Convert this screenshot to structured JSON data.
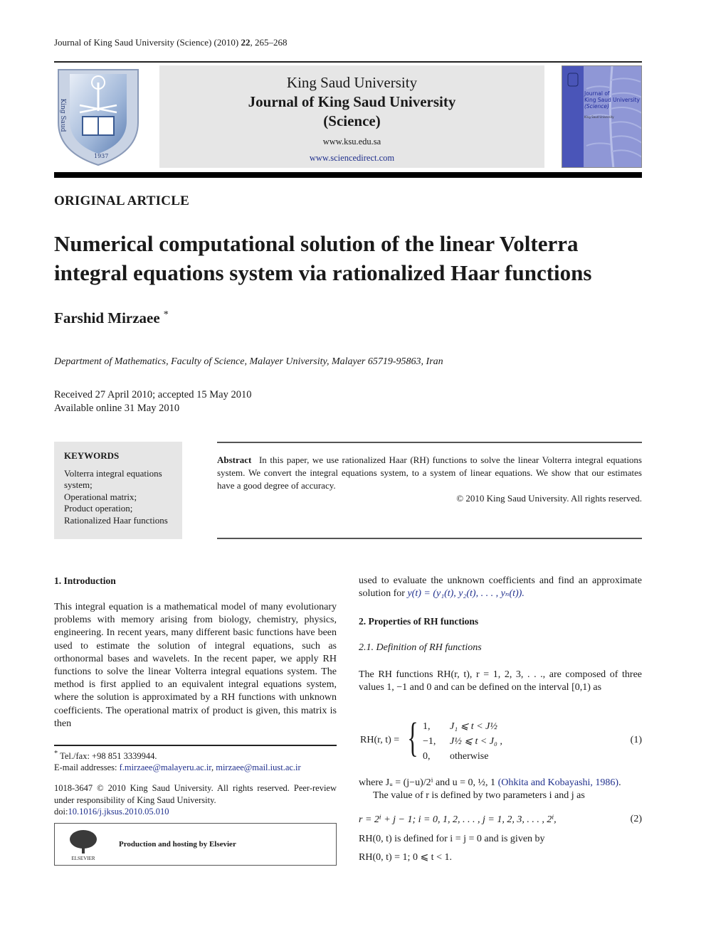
{
  "running_head": {
    "prefix": "Journal of King Saud University (Science) (2010) ",
    "volume": "22",
    "pages": ", 265–268"
  },
  "banner": {
    "logo": "king-saud-university-seal",
    "logo_year": "1937",
    "university": "King Saud University",
    "journal_line1": "Journal of King Saud University",
    "journal_line2": "(Science)",
    "url1": "www.ksu.edu.sa",
    "url2": "www.sciencedirect.com",
    "cover": {
      "line1": "Journal of",
      "line2": "King Saud University",
      "line3": "(Science)",
      "small": "King Saud University"
    }
  },
  "article_type": "ORIGINAL ARTICLE",
  "title": "Numerical computational solution of the linear Volterra integral equations system via rationalized Haar functions",
  "author": {
    "name": "Farshid Mirzaee",
    "marker": "*"
  },
  "affiliation": "Department of Mathematics, Faculty of Science, Malayer University, Malayer 65719-95863, Iran",
  "dates": {
    "received": "Received 27 April 2010; accepted 15 May 2010",
    "online": "Available online 31 May 2010"
  },
  "keywords": {
    "heading": "KEYWORDS",
    "items": [
      "Volterra integral equations system;",
      "Operational matrix;",
      "Product operation;",
      "Rationalized Haar functions"
    ]
  },
  "abstract": {
    "label": "Abstract",
    "text": "In this paper, we use rationalized Haar (RH) functions to solve the linear Volterra integral equations system. We convert the integral equations system, to a system of linear equations. We show that our estimates have a good degree of accuracy.",
    "copyright": "© 2010 King Saud University. All rights reserved."
  },
  "sections": {
    "intro_heading": "1. Introduction",
    "intro_text": "This integral equation is a mathematical model of many evolutionary problems with memory arising from biology, chemistry, physics, engineering. In recent years, many different basic functions have been used to estimate the solution of integral equations, such as orthonormal bases and wavelets. In the recent paper, we apply RH functions to solve the linear Volterra integral equations system. The method is first applied to an equivalent integral equations system, where the solution is approximated by a RH functions with unknown coefficients. The operational matrix of product is given, this matrix is then",
    "right_cont": "used to evaluate the unknown coefficients and find an approximate solution for ",
    "right_cont_math": "y(t) = (y₁(t), y₂(t), . . . , yₙ(t)).",
    "sec2_heading": "2. Properties of RH functions",
    "sec21_heading": "2.1. Definition of RH functions",
    "sec21_text": "The RH functions RH(r, t), r = 1, 2, 3, . . ., are composed of three values 1, −1 and 0 and can be defined on the interval [0,1) as",
    "eq1": {
      "lhs": "RH(r, t) =",
      "cases": [
        {
          "value": "1,",
          "cond": "J₁ ⩽ t < J½"
        },
        {
          "value": "−1,",
          "cond": "J½ ⩽ t < J₀ ,"
        },
        {
          "value": "0,",
          "cond": "otherwise"
        }
      ],
      "number": "(1)"
    },
    "where_text": "where Jᵤ = (j−u)/2ⁱ and u = 0, ½, 1 ",
    "where_cite": "(Ohkita and Kobayashi, 1986)",
    "where_end": ".",
    "r_def": "The value of r is defined by two parameters i and j as",
    "eq2": {
      "text": "r = 2ⁱ + j − 1;    i = 0, 1, 2, . . . ,    j = 1, 2, 3, . . . , 2ⁱ,",
      "number": "(2)"
    },
    "rh0_text": "RH(0, t) is defined for i = j = 0 and is given by",
    "rh0_eq": "RH(0, t) = 1;    0 ⩽ t < 1."
  },
  "footnotes": {
    "marker": "*",
    "tel": "Tel./fax: +98 851 3339944.",
    "email_label": "E-mail addresses: ",
    "email1": "f.mirzaee@malayeru.ac.ir",
    "email_sep": ", ",
    "email2": "mirzaee@mail.iust.ac.ir",
    "issn": "1018-3647 © 2010 King Saud University. All rights reserved. Peer-review under responsibility of King Saud University.",
    "doi_label": "doi:",
    "doi": "10.1016/j.jksus.2010.05.010",
    "elsevier_text": "Production and hosting by Elsevier",
    "elsevier_logo_label": "ELSEVIER"
  },
  "colors": {
    "link": "#1f2f8c",
    "gray_box": "#e6e6e6",
    "cover_blue": "#8f97d6"
  }
}
